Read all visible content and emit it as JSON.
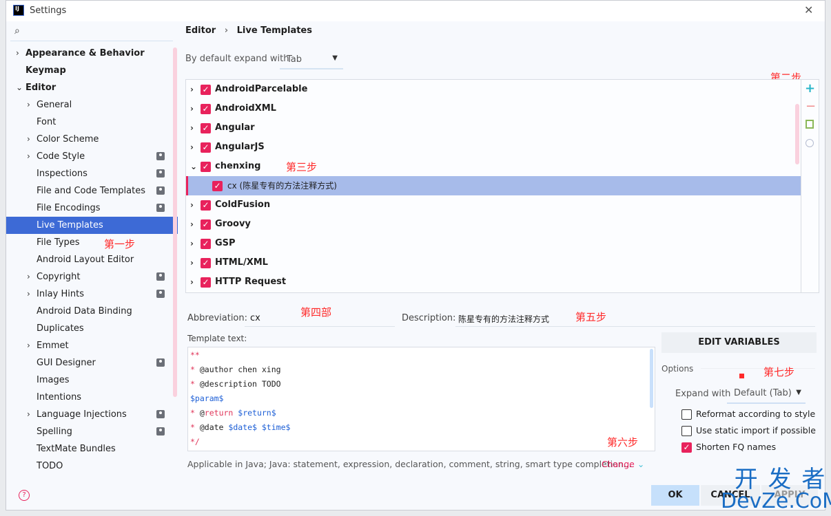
{
  "window": {
    "title": "Settings",
    "close": "✕"
  },
  "search": {
    "icon": "search-icon"
  },
  "sidebar": {
    "items": [
      {
        "label": "Appearance & Behavior",
        "bold": true,
        "chev": "›",
        "level": 0
      },
      {
        "label": "Keymap",
        "bold": true,
        "level": 0
      },
      {
        "label": "Editor",
        "bold": true,
        "chev": "⌄",
        "level": 0
      },
      {
        "label": "General",
        "chev": "›",
        "level": 1
      },
      {
        "label": "Font",
        "level": 1
      },
      {
        "label": "Color Scheme",
        "chev": "›",
        "level": 1
      },
      {
        "label": "Code Style",
        "chev": "›",
        "level": 1,
        "badge": true
      },
      {
        "label": "Inspections",
        "level": 1,
        "badge": true
      },
      {
        "label": "File and Code Templates",
        "level": 1,
        "badge": true
      },
      {
        "label": "File Encodings",
        "level": 1,
        "badge": true
      },
      {
        "label": "Live Templates",
        "level": 1,
        "selected": true
      },
      {
        "label": "File Types",
        "level": 1
      },
      {
        "label": "Android Layout Editor",
        "level": 1
      },
      {
        "label": "Copyright",
        "chev": "›",
        "level": 1,
        "badge": true
      },
      {
        "label": "Inlay Hints",
        "chev": "›",
        "level": 1,
        "badge": true
      },
      {
        "label": "Android Data Binding",
        "level": 1
      },
      {
        "label": "Duplicates",
        "level": 1
      },
      {
        "label": "Emmet",
        "chev": "›",
        "level": 1
      },
      {
        "label": "GUI Designer",
        "level": 1,
        "badge": true
      },
      {
        "label": "Images",
        "level": 1
      },
      {
        "label": "Intentions",
        "level": 1
      },
      {
        "label": "Language Injections",
        "chev": "›",
        "level": 1,
        "badge": true
      },
      {
        "label": "Spelling",
        "level": 1,
        "badge": true
      },
      {
        "label": "TextMate Bundles",
        "level": 1
      },
      {
        "label": "TODO",
        "level": 1
      }
    ]
  },
  "breadcrumb": {
    "parent": "Editor",
    "sep": "›",
    "current": "Live Templates"
  },
  "expand": {
    "label": "By default expand with",
    "value": "Tab"
  },
  "templates": [
    {
      "label": "AndroidParcelable",
      "chev": "›"
    },
    {
      "label": "AndroidXML",
      "chev": "›"
    },
    {
      "label": "Angular",
      "chev": "›"
    },
    {
      "label": "AngularJS",
      "chev": "›"
    },
    {
      "label": "chenxing",
      "chev": "⌄"
    },
    {
      "label": "cx (陈星专有的方法注释方式)",
      "child": true,
      "selected": true
    },
    {
      "label": "ColdFusion",
      "chev": "›"
    },
    {
      "label": "Groovy",
      "chev": "›"
    },
    {
      "label": "GSP",
      "chev": "›"
    },
    {
      "label": "HTML/XML",
      "chev": "›"
    },
    {
      "label": "HTTP Request",
      "chev": "›"
    }
  ],
  "toolbar": {
    "add": "+",
    "remove": "−"
  },
  "annotations": {
    "step1": "第一步",
    "step2": "第二步",
    "step3": "第三步",
    "step4": "第四部",
    "step5": "第五步",
    "step6": "第六步",
    "step7": "第七步"
  },
  "abbreviation": {
    "label": "Abbreviation:",
    "value": "cx"
  },
  "description": {
    "label": "Description:",
    "value": "陈星专有的方法注释方式"
  },
  "template_text": {
    "label": "Template text:",
    "lines": [
      [
        {
          "t": "**",
          "c": "#e0365a"
        }
      ],
      [
        {
          "t": "* ",
          "c": "#e0365a"
        },
        {
          "t": "@author chen xing",
          "c": "#222"
        }
      ],
      [
        {
          "t": "* ",
          "c": "#e0365a"
        },
        {
          "t": "@description TODO",
          "c": "#222"
        }
      ],
      [
        {
          "t": "$param$",
          "c": "#1d5fd6"
        }
      ],
      [
        {
          "t": "* ",
          "c": "#e0365a"
        },
        {
          "t": "@",
          "c": "#222"
        },
        {
          "t": "return ",
          "c": "#e0365a"
        },
        {
          "t": "$return$",
          "c": "#1d5fd6"
        }
      ],
      [
        {
          "t": "* ",
          "c": "#e0365a"
        },
        {
          "t": "@date ",
          "c": "#222"
        },
        {
          "t": "$date$ $time$",
          "c": "#1d5fd6"
        }
      ],
      [
        {
          "t": "*/",
          "c": "#e0365a"
        }
      ]
    ]
  },
  "applicable": {
    "text": "Applicable in Java; Java: statement, expression, declaration, comment, string, smart type completion...",
    "change": "Change"
  },
  "edit_variables": "EDIT VARIABLES",
  "options": {
    "label": "Options",
    "expand_label": "Expand with",
    "expand_value": "Default (Tab)",
    "checks": [
      {
        "label": "Reformat according to style",
        "checked": false
      },
      {
        "label": "Use static import if possible",
        "checked": false
      },
      {
        "label": "Shorten FQ names",
        "checked": true
      }
    ]
  },
  "buttons": {
    "ok": "OK",
    "cancel": "CANCEL",
    "apply": "APPLY"
  },
  "watermark": {
    "line1": "开 发 者",
    "line2": "DevZe.CoM"
  },
  "colors": {
    "accent": "#3d6ad6",
    "checkbox": "#e8225c",
    "selection": "#a7bbea",
    "annotation": "#ff2a2a"
  }
}
